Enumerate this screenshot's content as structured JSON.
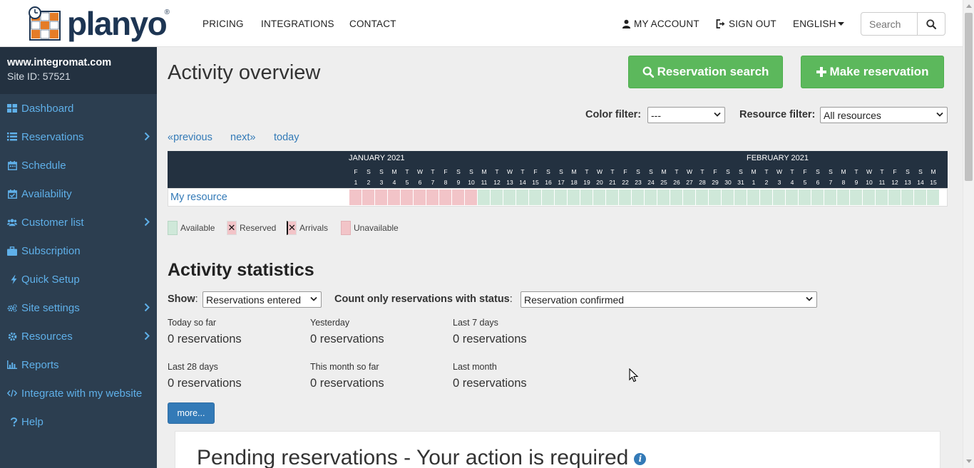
{
  "brand": {
    "name": "planyo",
    "reg": "®"
  },
  "nav": {
    "pricing": "PRICING",
    "integrations": "INTEGRATIONS",
    "contact": "CONTACT",
    "my_account": "MY ACCOUNT",
    "sign_out": "SIGN OUT",
    "language": "ENGLISH",
    "search_placeholder": "Search"
  },
  "site": {
    "name": "www.integromat.com",
    "id": "Site ID: 57521"
  },
  "sidebar": {
    "items": [
      {
        "label": "Dashboard",
        "icon": "dashboard-icon",
        "submenu": false
      },
      {
        "label": "Reservations",
        "icon": "list-icon",
        "submenu": true
      },
      {
        "label": "Schedule",
        "icon": "calendar-icon",
        "submenu": false
      },
      {
        "label": "Availability",
        "icon": "calendar-check-icon",
        "submenu": false
      },
      {
        "label": "Customer list",
        "icon": "users-icon",
        "submenu": true
      },
      {
        "label": "Subscription",
        "icon": "briefcase-icon",
        "submenu": false
      },
      {
        "label": "Quick Setup",
        "icon": "bolt-icon",
        "submenu": false
      },
      {
        "label": "Site settings",
        "icon": "cogs-icon",
        "submenu": true
      },
      {
        "label": "Resources",
        "icon": "cog-icon",
        "submenu": true
      },
      {
        "label": "Reports",
        "icon": "bar-chart-icon",
        "submenu": false
      },
      {
        "label": "Integrate with my website",
        "icon": "code-icon",
        "submenu": false
      },
      {
        "label": "Help",
        "icon": "question-icon",
        "submenu": false
      }
    ]
  },
  "main": {
    "title": "Activity overview",
    "reservation_search": "Reservation search",
    "make_reservation": "Make reservation",
    "color_filter_label": "Color filter:",
    "color_filter_value": "---",
    "resource_filter_label": "Resource filter:",
    "resource_filter_value": "All resources",
    "prev": "«previous",
    "next": "next»",
    "today": "today"
  },
  "calendar": {
    "months": [
      {
        "label": "JANUARY 2021",
        "start_index": 0
      },
      {
        "label": "FEBRUARY 2021",
        "start_index": 31
      }
    ],
    "days": [
      [
        "F",
        "1"
      ],
      [
        "S",
        "2"
      ],
      [
        "S",
        "3"
      ],
      [
        "M",
        "4"
      ],
      [
        "T",
        "5"
      ],
      [
        "W",
        "6"
      ],
      [
        "T",
        "7"
      ],
      [
        "F",
        "8"
      ],
      [
        "S",
        "9"
      ],
      [
        "S",
        "10"
      ],
      [
        "M",
        "11"
      ],
      [
        "T",
        "12"
      ],
      [
        "W",
        "13"
      ],
      [
        "T",
        "14"
      ],
      [
        "F",
        "15"
      ],
      [
        "S",
        "16"
      ],
      [
        "S",
        "17"
      ],
      [
        "M",
        "18"
      ],
      [
        "T",
        "19"
      ],
      [
        "W",
        "20"
      ],
      [
        "T",
        "21"
      ],
      [
        "F",
        "22"
      ],
      [
        "S",
        "23"
      ],
      [
        "S",
        "24"
      ],
      [
        "M",
        "25"
      ],
      [
        "T",
        "26"
      ],
      [
        "W",
        "27"
      ],
      [
        "T",
        "28"
      ],
      [
        "F",
        "29"
      ],
      [
        "S",
        "30"
      ],
      [
        "S",
        "31"
      ],
      [
        "M",
        "1"
      ],
      [
        "T",
        "2"
      ],
      [
        "W",
        "3"
      ],
      [
        "T",
        "4"
      ],
      [
        "F",
        "5"
      ],
      [
        "S",
        "6"
      ],
      [
        "S",
        "7"
      ],
      [
        "M",
        "8"
      ],
      [
        "T",
        "9"
      ],
      [
        "W",
        "10"
      ],
      [
        "T",
        "11"
      ],
      [
        "F",
        "12"
      ],
      [
        "S",
        "13"
      ],
      [
        "S",
        "14"
      ],
      [
        "M",
        "15"
      ]
    ],
    "resource": "My resource",
    "unavailable_days": 10,
    "colors": {
      "available": "#cfe8d9",
      "unavailable": "#f2c4c8"
    }
  },
  "legend": {
    "available": "Available",
    "reserved": "Reserved",
    "arrivals": "Arrivals",
    "unavailable": "Unavailable"
  },
  "stats": {
    "title": "Activity statistics",
    "show_label": "Show",
    "show_value": "Reservations entered",
    "status_label": "Count only reservations with status",
    "status_value": "Reservation confirmed",
    "items": [
      {
        "label": "Today so far",
        "value": "0 reservations"
      },
      {
        "label": "Yesterday",
        "value": "0 reservations"
      },
      {
        "label": "Last 7 days",
        "value": "0 reservations"
      },
      {
        "label": "Last 28 days",
        "value": "0 reservations"
      },
      {
        "label": "This month so far",
        "value": "0 reservations"
      },
      {
        "label": "Last month",
        "value": "0 reservations"
      }
    ],
    "more": "more..."
  },
  "pending": {
    "title": "Pending reservations - Your action is required"
  }
}
